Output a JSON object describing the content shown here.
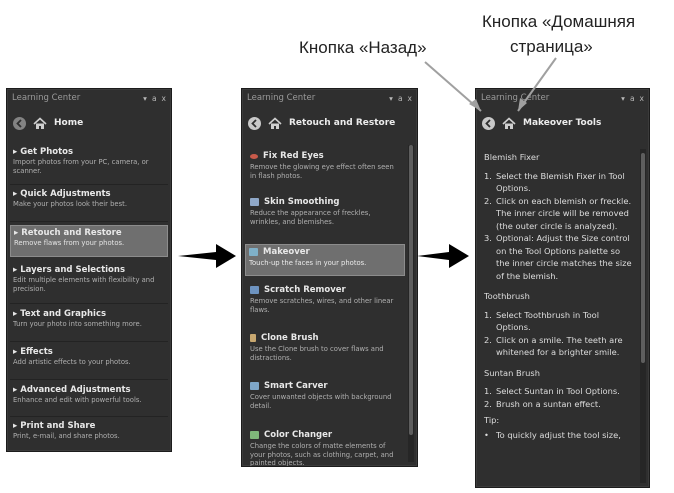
{
  "callouts": {
    "back": "Кнопка «Назад»",
    "home_line1": "Кнопка «Домашняя",
    "home_line2": "страница»"
  },
  "panel_common": {
    "title": "Learning Center",
    "controls": [
      "▾",
      "а",
      "x"
    ]
  },
  "home_panel": {
    "heading": "Home",
    "items": [
      {
        "title": "Get Photos",
        "desc": "Import photos from your PC, camera, or scanner.",
        "selected": false
      },
      {
        "title": "Quick Adjustments",
        "desc": "Make your photos look their best.",
        "selected": false
      },
      {
        "title": "Retouch and Restore",
        "desc": "Remove flaws from your photos.",
        "selected": true
      },
      {
        "title": "Layers and Selections",
        "desc": "Edit multiple elements with flexibility and precision.",
        "selected": false
      },
      {
        "title": "Text and Graphics",
        "desc": "Turn your photo into something more.",
        "selected": false
      },
      {
        "title": "Effects",
        "desc": "Add artistic effects to your photos.",
        "selected": false
      },
      {
        "title": "Advanced Adjustments",
        "desc": "Enhance and edit with powerful tools.",
        "selected": false
      },
      {
        "title": "Print and Share",
        "desc": "Print, e-mail, and share photos.",
        "selected": false
      }
    ]
  },
  "retouch_panel": {
    "heading": "Retouch and Restore",
    "tools": [
      {
        "title": "Fix Red Eyes",
        "desc": "Remove the glowing eye effect often seen in flash photos.",
        "icon": "red-eye-icon",
        "selected": false
      },
      {
        "title": "Skin Smoothing",
        "desc": "Reduce the appearance of freckles, wrinkles, and blemishes.",
        "icon": "skin-smoothing-icon",
        "selected": false
      },
      {
        "title": "Makeover",
        "desc": "Touch-up the faces in your photos.",
        "icon": "makeover-icon",
        "selected": true
      },
      {
        "title": "Scratch Remover",
        "desc": "Remove scratches, wires, and other linear flaws.",
        "icon": "scratch-remover-icon",
        "selected": false
      },
      {
        "title": "Clone Brush",
        "desc": "Use the Clone brush to cover flaws and distractions.",
        "icon": "clone-brush-icon",
        "selected": false
      },
      {
        "title": "Smart Carver",
        "desc": "Cover unwanted objects with background detail.",
        "icon": "smart-carver-icon",
        "selected": false
      },
      {
        "title": "Color Changer",
        "desc": "Change the colors of matte elements of your photos, such as clothing, carpet, and painted objects.",
        "icon": "color-changer-icon",
        "selected": false
      }
    ]
  },
  "makeover_panel": {
    "heading": "Makeover Tools",
    "blemish": {
      "title": "Blemish Fixer",
      "steps": [
        "Select the Blemish Fixer in Tool Options.",
        "Click on each blemish or freckle. The inner circle will be removed (the outer circle is analyzed).",
        "Optional: Adjust the Size control on the Tool Options palette so the inner circle matches the size of the blemish."
      ]
    },
    "toothbrush": {
      "title": "Toothbrush",
      "steps": [
        "Select Toothbrush in Tool Options.",
        "Click on a smile. The teeth are whitened for a brighter smile."
      ]
    },
    "suntan": {
      "title": "Suntan Brush",
      "steps": [
        "Select Suntan in Tool Options.",
        "Brush on a suntan effect."
      ]
    },
    "tip": {
      "title": "Tip:",
      "text": "To quickly adjust the tool size,"
    }
  },
  "colors": {
    "panel_bg": "#2f2f2f",
    "selected_bg": "#6f6f6f",
    "arrow": "#000000"
  }
}
